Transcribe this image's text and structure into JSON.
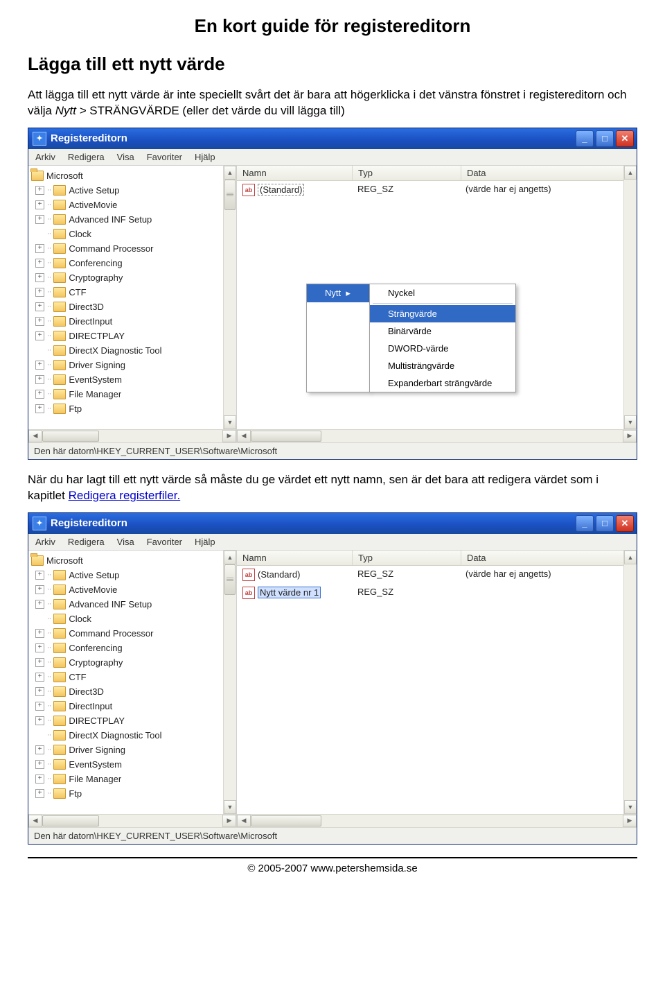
{
  "doc": {
    "title": "En kort guide för registereditorn",
    "section_title": "Lägga till ett nytt värde",
    "p1_a": "Att lägga till ett nytt värde är inte speciellt svårt det är bara att högerklicka i det vänstra fönstret i registereditorn och välja ",
    "p1_action": "Nytt > ",
    "p1_b": "STRÄNGVÄRDE (eller det värde du vill lägga till)",
    "p2_a": "När du har lagt till ett nytt värde så måste du ge värdet ett nytt namn, sen är det bara att redigera värdet som i kapitlet ",
    "p2_link": "Redigera registerfiler.",
    "footer": "© 2005-2007 www.petershemsida.se"
  },
  "regedit": {
    "title": "Registereditorn",
    "menus": [
      "Arkiv",
      "Redigera",
      "Visa",
      "Favoriter",
      "Hjälp"
    ],
    "tree_root": "Microsoft",
    "tree_items": [
      {
        "exp": "+",
        "label": "Active Setup"
      },
      {
        "exp": "+",
        "label": "ActiveMovie"
      },
      {
        "exp": "+",
        "label": "Advanced INF Setup"
      },
      {
        "exp": "",
        "label": "Clock"
      },
      {
        "exp": "+",
        "label": "Command Processor"
      },
      {
        "exp": "+",
        "label": "Conferencing"
      },
      {
        "exp": "+",
        "label": "Cryptography"
      },
      {
        "exp": "+",
        "label": "CTF"
      },
      {
        "exp": "+",
        "label": "Direct3D"
      },
      {
        "exp": "+",
        "label": "DirectInput"
      },
      {
        "exp": "+",
        "label": "DIRECTPLAY"
      },
      {
        "exp": "",
        "label": "DirectX Diagnostic Tool"
      },
      {
        "exp": "+",
        "label": "Driver Signing"
      },
      {
        "exp": "+",
        "label": "EventSystem"
      },
      {
        "exp": "+",
        "label": "File Manager"
      },
      {
        "exp": "+",
        "label": "Ftp"
      }
    ],
    "status": "Den här datorn\\HKEY_CURRENT_USER\\Software\\Microsoft",
    "headers": {
      "name": "Namn",
      "type": "Typ",
      "data": "Data"
    },
    "row_default": {
      "name": "(Standard)",
      "type": "REG_SZ",
      "data": "(värde har ej angetts)"
    },
    "row_new": {
      "name": "Nytt värde nr 1",
      "type": "REG_SZ",
      "data": ""
    },
    "context_parent": "Nytt",
    "context_items": [
      "Nyckel",
      "Strängvärde",
      "Binärvärde",
      "DWORD-värde",
      "Multisträngvärde",
      "Expanderbart strängvärde"
    ],
    "context_selected_index": 1
  }
}
